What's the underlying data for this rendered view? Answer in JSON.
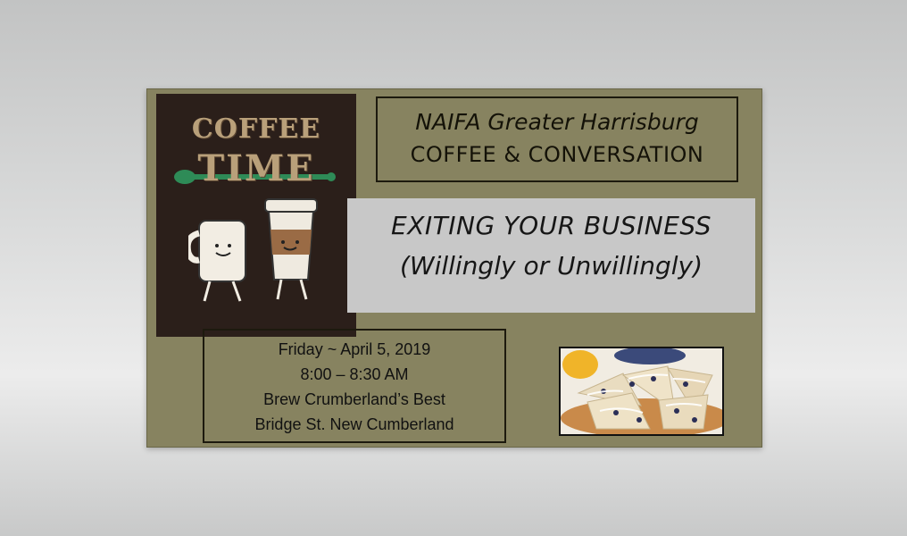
{
  "logo": {
    "line1": "COFFEE",
    "line2": "TIME"
  },
  "header": {
    "org": "NAIFA Greater Harrisburg",
    "event": "COFFEE & CONVERSATION"
  },
  "topic": {
    "line1": "EXITING YOUR BUSINESS",
    "line2": "(Willingly or Unwillingly)"
  },
  "details": {
    "date": "Friday ~ April 5, 2019",
    "time": "8:00 – 8:30 AM",
    "venue": "Brew Crumberland’s Best",
    "address": "Bridge St. New Cumberland"
  },
  "colors": {
    "slide_background": "#878360",
    "logo_background": "#2b1f1a",
    "topic_background": "#c8c8c8",
    "logo_accent": "#2e8b57"
  },
  "icons": [
    "coffee-mug-icon",
    "to-go-cup-icon",
    "spoon-icon"
  ]
}
